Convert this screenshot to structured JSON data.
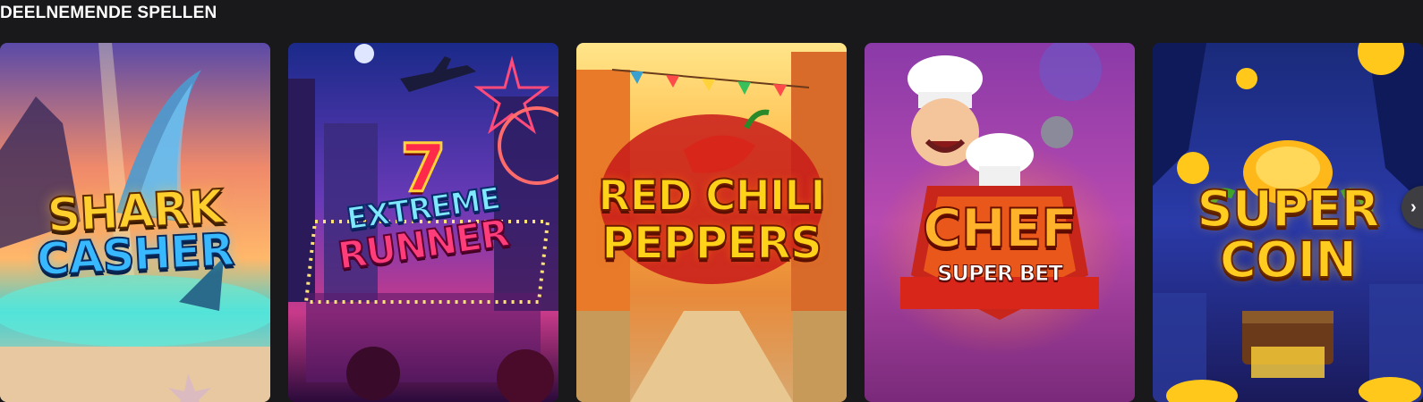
{
  "section": {
    "title": "DEELNEMENDE SPELLEN"
  },
  "games": [
    {
      "logo_line1": "SHARK",
      "logo_line2": "CASHER"
    },
    {
      "logo_top": "7",
      "logo_line1": "EXTREME",
      "logo_line2": "RUNNER"
    },
    {
      "logo_line1": "RED CHILI",
      "logo_line2": "PEPPERS"
    },
    {
      "logo_line1": "CHEF",
      "logo_line2": "SUPER BET"
    },
    {
      "logo_line1": "SUPER",
      "logo_line2": "COIN"
    }
  ],
  "carousel": {
    "next_icon": "chevron-right-icon",
    "next_glyph": "›"
  },
  "colors": {
    "background": "#19181b",
    "title": "#ffffff",
    "nav_button": "#3d3d42"
  }
}
